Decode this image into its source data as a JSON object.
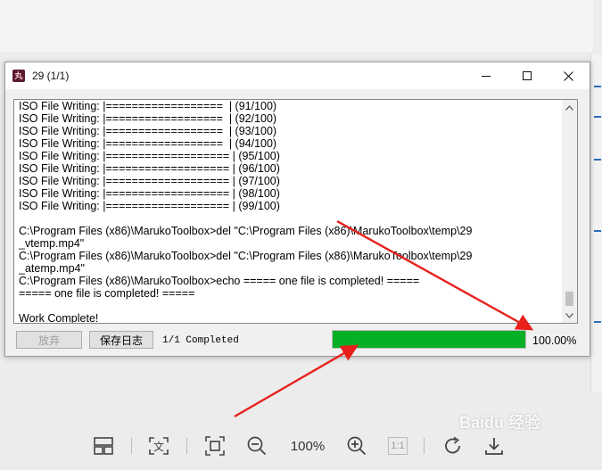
{
  "window": {
    "title": "29 (1/1)",
    "app_icon_text": "丸"
  },
  "log_lines": [
    "ISO File Writing: |==================  | (91/100)",
    "ISO File Writing: |==================  | (92/100)",
    "ISO File Writing: |==================  | (93/100)",
    "ISO File Writing: |==================  | (94/100)",
    "ISO File Writing: |=================== | (95/100)",
    "ISO File Writing: |=================== | (96/100)",
    "ISO File Writing: |=================== | (97/100)",
    "ISO File Writing: |=================== | (98/100)",
    "ISO File Writing: |=================== | (99/100)",
    "",
    "C:\\Program Files (x86)\\MarukoToolbox>del \"C:\\Program Files (x86)\\MarukoToolbox\\temp\\29",
    "_vtemp.mp4\"",
    "C:\\Program Files (x86)\\MarukoToolbox>del \"C:\\Program Files (x86)\\MarukoToolbox\\temp\\29",
    "_atemp.mp4\"",
    "C:\\Program Files (x86)\\MarukoToolbox>echo ===== one file is completed! =====",
    "===== one file is completed! =====",
    "",
    "Work Complete!"
  ],
  "buttons": {
    "give_up": "放弃",
    "save_log": "保存日志"
  },
  "status_text": "1/1 Completed",
  "progress": {
    "fraction": 1.0,
    "label": "100.00%",
    "color": "#06b025"
  },
  "viewer_toolbar": {
    "zoom": "100%",
    "actual_size": "1:1"
  },
  "watermark": "Baidu 经验"
}
